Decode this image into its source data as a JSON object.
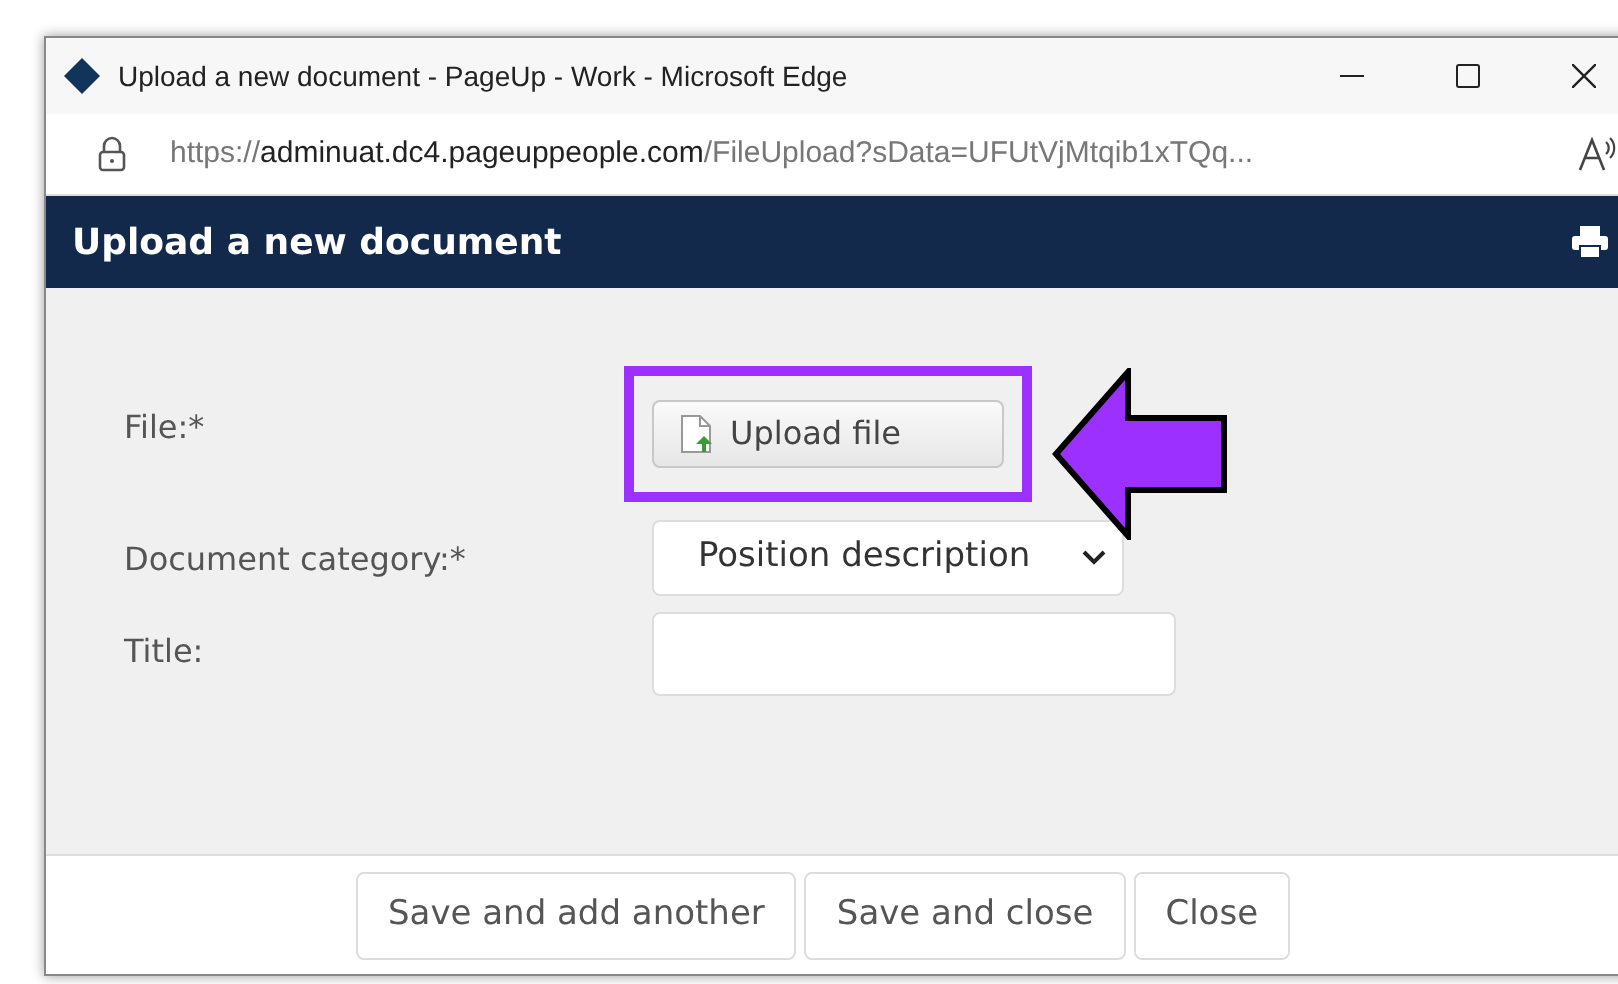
{
  "window": {
    "title": "Upload a new document - PageUp - Work - Microsoft Edge"
  },
  "address_bar": {
    "scheme": "https://",
    "host": "adminuat.dc4.pageuppeople.com",
    "path": "/FileUpload?sData=UFUtVjMtqib1xTQq..."
  },
  "header": {
    "title": "Upload a new document"
  },
  "form": [
    {
      "kind": "file",
      "label": "File:*",
      "button": "Upload file",
      "highlighted": true
    },
    {
      "kind": "select",
      "label": "Document category:*",
      "value": "Position description"
    },
    {
      "kind": "text",
      "label": "Title:"
    }
  ],
  "buttons": [
    "Save and add another",
    "Save and close",
    "Close"
  ]
}
